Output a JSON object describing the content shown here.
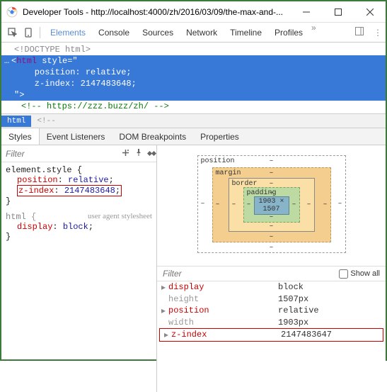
{
  "window": {
    "title": "Developer Tools - http://localhost:4000/zh/2016/03/09/the-max-and-..."
  },
  "toolbar": {
    "tabs": [
      "Elements",
      "Console",
      "Sources",
      "Network",
      "Timeline",
      "Profiles"
    ],
    "active": 0
  },
  "source": {
    "line1": "<!DOCTYPE html>",
    "line2_open": "<html",
    "line2_attr": " style=\"",
    "line3": "    position: relative;",
    "line4": "    z-index: 2147483648;",
    "line5": "\">",
    "line6": "<!-- https://zzz.buzz/zh/ -->"
  },
  "breadcrumb": {
    "item1": "html",
    "item2": "<!--"
  },
  "subtabs": [
    "Styles",
    "Event Listeners",
    "DOM Breakpoints",
    "Properties"
  ],
  "stylesPane": {
    "filter_placeholder": "Filter",
    "rule1_sel": "element.style",
    "decl1_prop": "position",
    "decl1_val": "relative",
    "decl2_prop": "z-index",
    "decl2_val": "2147483648",
    "rule2_sel": "html",
    "rule2_ua": "user agent stylesheet",
    "decl3_prop": "display",
    "decl3_val": "block"
  },
  "boxmodel": {
    "position": "position",
    "margin": "margin",
    "border": "border",
    "padding": "padding",
    "content": "1903 × 1507",
    "dash": "–"
  },
  "computedFilter": {
    "placeholder": "Filter",
    "showall": "Show all"
  },
  "computed": [
    {
      "prop": "display",
      "val": "block",
      "hl": true,
      "tri": true
    },
    {
      "prop": "height",
      "val": "1507px",
      "hl": false,
      "tri": false
    },
    {
      "prop": "position",
      "val": "relative",
      "hl": true,
      "tri": true
    },
    {
      "prop": "width",
      "val": "1903px",
      "hl": false,
      "tri": false
    },
    {
      "prop": "z-index",
      "val": "2147483647",
      "hl": true,
      "tri": true,
      "boxed": true
    }
  ]
}
